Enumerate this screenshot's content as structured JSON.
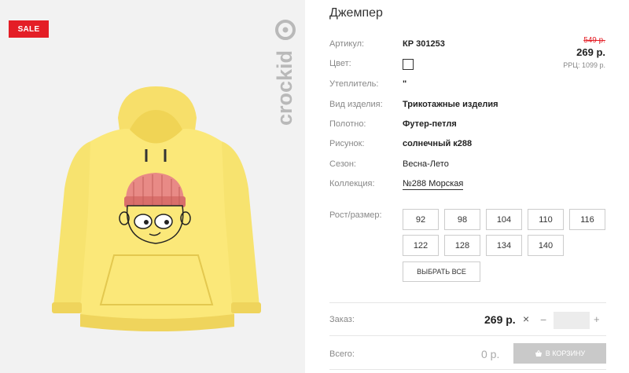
{
  "product": {
    "title": "Джемпер",
    "sale_badge": "SALE",
    "brand": "crockid"
  },
  "specs": [
    {
      "label": "Артикул:",
      "value": "КР 301253"
    },
    {
      "label": "Цвет:",
      "value": ""
    },
    {
      "label": "Утеплитель:",
      "value": "\""
    },
    {
      "label": "Вид изделия:",
      "value": "Трикотажные изделия"
    },
    {
      "label": "Полотно:",
      "value": "Футер-петля"
    },
    {
      "label": "Рисунок:",
      "value": "солнечный к288"
    },
    {
      "label": "Сезон:",
      "value": "Весна-Лето"
    },
    {
      "label": "Коллекция:",
      "value": "№288 Морская"
    }
  ],
  "pricing": {
    "old": "549 р.",
    "new": "269 р.",
    "rrp": "РРЦ: 1099 р."
  },
  "sizes": {
    "label": "Рост/размер:",
    "options": [
      "92",
      "98",
      "104",
      "110",
      "116",
      "122",
      "128",
      "134",
      "140"
    ],
    "select_all": "ВЫБРАТЬ ВСЕ"
  },
  "order": {
    "label": "Заказ:",
    "price": "269 р.",
    "times": "×",
    "minus": "−",
    "plus": "+",
    "quantity": ""
  },
  "total": {
    "label": "Всего:",
    "value": "0 р.",
    "cart_button": "В КОРЗИНУ"
  },
  "colors": {
    "sale": "#e41e26",
    "hoodie": "#fbe879",
    "cart_button_disabled": "#c9c9c9"
  }
}
